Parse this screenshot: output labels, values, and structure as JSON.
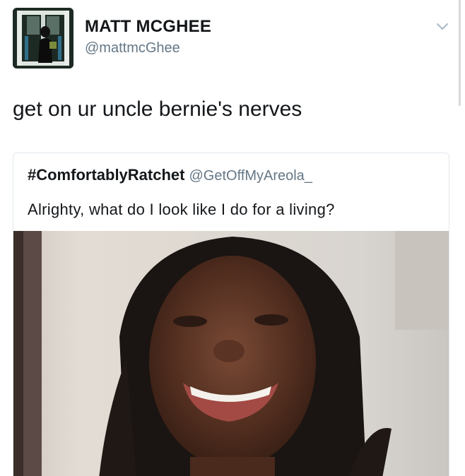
{
  "tweet": {
    "author_name": "MATT MCGHEE",
    "author_handle": "@mattmcGhee",
    "text": "get on ur uncle bernie's nerves",
    "menu_icon": "chevron-down-icon"
  },
  "quoted_tweet": {
    "author_name": "#ComfortablyRatchet",
    "author_handle": "@GetOffMyAreola_",
    "text": "Alrighty, what do I look like I do for a living?",
    "media_type": "photo"
  }
}
